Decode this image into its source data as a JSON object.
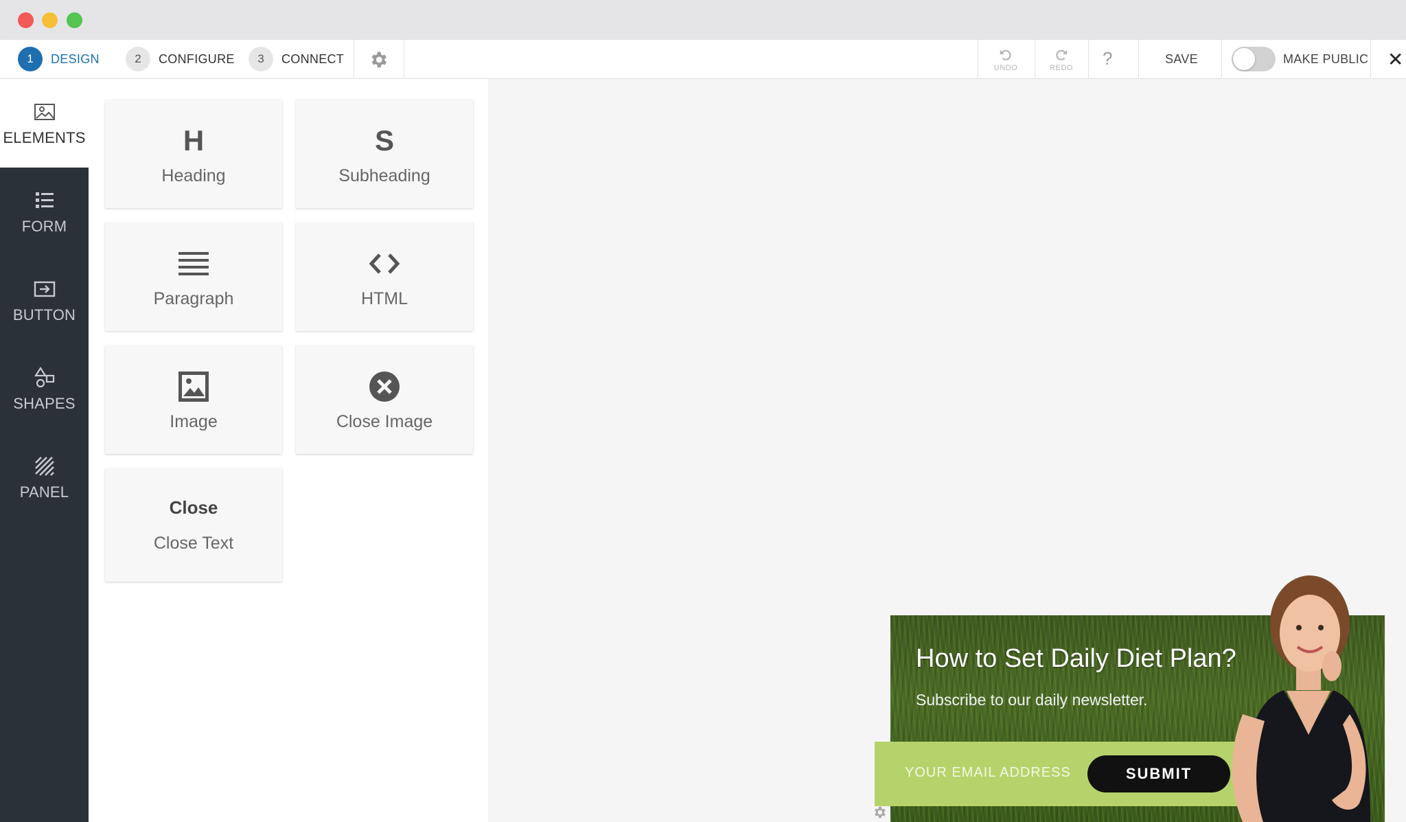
{
  "steps": [
    {
      "num": "1",
      "label": "DESIGN"
    },
    {
      "num": "2",
      "label": "CONFIGURE"
    },
    {
      "num": "3",
      "label": "CONNECT"
    }
  ],
  "toolbar": {
    "undo_label": "UNDO",
    "redo_label": "REDO",
    "help_label": "?",
    "save_label": "SAVE",
    "make_public_label": "MAKE PUBLIC",
    "close_label": "✕"
  },
  "sidebar": {
    "items": [
      {
        "label": "ELEMENTS",
        "icon": "image-icon"
      },
      {
        "label": "FORM",
        "icon": "list-icon"
      },
      {
        "label": "BUTTON",
        "icon": "button-icon"
      },
      {
        "label": "SHAPES",
        "icon": "shapes-icon"
      },
      {
        "label": "PANEL",
        "icon": "panel-icon"
      }
    ]
  },
  "elements": [
    {
      "glyph": "H",
      "label": "Heading"
    },
    {
      "glyph": "S",
      "label": "Subheading"
    },
    {
      "glyph": "≡",
      "label": "Paragraph"
    },
    {
      "glyph": "<>",
      "label": "HTML"
    },
    {
      "glyph": "",
      "label": "Image"
    },
    {
      "glyph": "",
      "label": "Close Image"
    },
    {
      "glyph": "Close",
      "label": "Close Text"
    }
  ],
  "popup": {
    "title": "How to Set Daily Diet Plan?",
    "subtitle": "Subscribe to our daily newsletter.",
    "email_placeholder": "YOUR EMAIL ADDRESS",
    "submit_label": "SUBMIT"
  },
  "colors": {
    "accent": "#1e6fb0",
    "sidebar_bg": "#2b3139",
    "email_bar": "#b6d36b"
  }
}
